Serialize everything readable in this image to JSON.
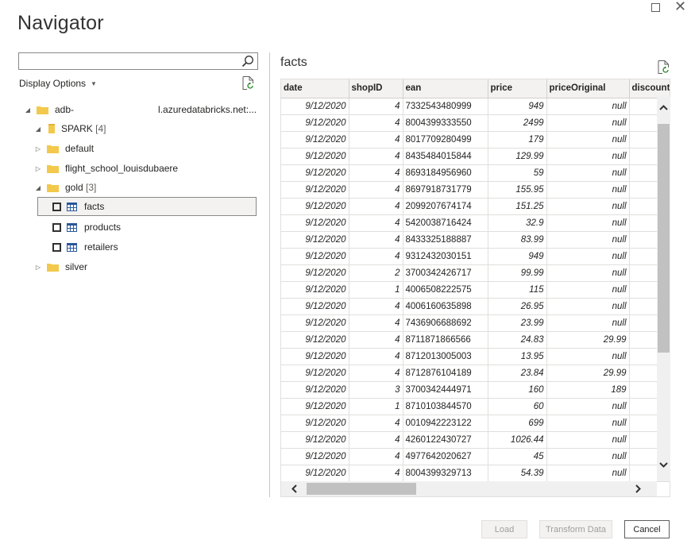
{
  "window": {
    "title": "Navigator",
    "maximize_glyph": "",
    "close_glyph": "✕"
  },
  "search": {
    "value": "",
    "placeholder": ""
  },
  "display_options": {
    "label": "Display Options"
  },
  "tree": {
    "server": {
      "label_prefix": "adb-",
      "label_suffix": "l.azuredatabricks.net:..."
    },
    "spark": {
      "label": "SPARK",
      "count": "[4]"
    },
    "schemas": [
      {
        "label": "default"
      },
      {
        "label": "flight_school_louisdubaere"
      },
      {
        "label": "gold",
        "count": "[3]"
      },
      {
        "label": "silver"
      }
    ],
    "tables": [
      {
        "label": "facts"
      },
      {
        "label": "products"
      },
      {
        "label": "retailers"
      }
    ]
  },
  "preview": {
    "title": "facts",
    "columns": [
      "date",
      "shopID",
      "ean",
      "price",
      "priceOriginal",
      "discounte"
    ],
    "rows": [
      [
        "9/12/2020",
        "4",
        "7332543480999",
        "949",
        "null",
        ""
      ],
      [
        "9/12/2020",
        "4",
        "8004399333550",
        "2499",
        "null",
        ""
      ],
      [
        "9/12/2020",
        "4",
        "8017709280499",
        "179",
        "null",
        ""
      ],
      [
        "9/12/2020",
        "4",
        "8435484015844",
        "129.99",
        "null",
        ""
      ],
      [
        "9/12/2020",
        "4",
        "8693184956960",
        "59",
        "null",
        ""
      ],
      [
        "9/12/2020",
        "4",
        "8697918731779",
        "155.95",
        "null",
        ""
      ],
      [
        "9/12/2020",
        "4",
        "2099207674174",
        "151.25",
        "null",
        ""
      ],
      [
        "9/12/2020",
        "4",
        "5420038716424",
        "32.9",
        "null",
        ""
      ],
      [
        "9/12/2020",
        "4",
        "8433325188887",
        "83.99",
        "null",
        ""
      ],
      [
        "9/12/2020",
        "4",
        "9312432030151",
        "949",
        "null",
        ""
      ],
      [
        "9/12/2020",
        "2",
        "3700342426717",
        "99.99",
        "null",
        ""
      ],
      [
        "9/12/2020",
        "1",
        "4006508222575",
        "115",
        "null",
        ""
      ],
      [
        "9/12/2020",
        "4",
        "4006160635898",
        "26.95",
        "null",
        ""
      ],
      [
        "9/12/2020",
        "4",
        "7436906688692",
        "23.99",
        "null",
        ""
      ],
      [
        "9/12/2020",
        "4",
        "8711871866566",
        "24.83",
        "29.99",
        ""
      ],
      [
        "9/12/2020",
        "4",
        "8712013005003",
        "13.95",
        "null",
        ""
      ],
      [
        "9/12/2020",
        "4",
        "8712876104189",
        "23.84",
        "29.99",
        ""
      ],
      [
        "9/12/2020",
        "3",
        "3700342444971",
        "160",
        "189",
        ""
      ],
      [
        "9/12/2020",
        "1",
        "8710103844570",
        "60",
        "null",
        ""
      ],
      [
        "9/12/2020",
        "4",
        "0010942223122",
        "699",
        "null",
        ""
      ],
      [
        "9/12/2020",
        "4",
        "4260122430727",
        "1026.44",
        "null",
        ""
      ],
      [
        "9/12/2020",
        "4",
        "4977642020627",
        "45",
        "null",
        ""
      ],
      [
        "9/12/2020",
        "4",
        "8004399329713",
        "54.39",
        "null",
        ""
      ]
    ]
  },
  "buttons": {
    "load": "Load",
    "transform": "Transform Data",
    "cancel": "Cancel"
  },
  "colors": {
    "folder": "#f2c94c",
    "accent_blue": "#2b579a"
  }
}
